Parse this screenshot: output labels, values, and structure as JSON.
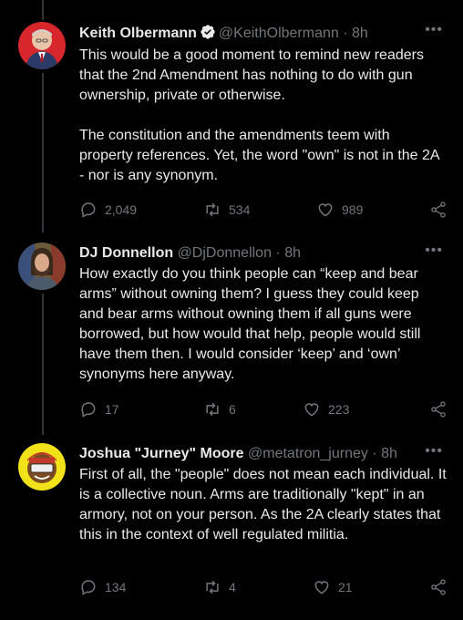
{
  "colors": {
    "background": "#000000",
    "text": "#e7e9ea",
    "muted": "#71767b",
    "verified": "#e7e9ea"
  },
  "tweets": [
    {
      "name": "Keith Olbermann",
      "verified": true,
      "handle": "@KeithOlbermann",
      "separator": "·",
      "time": "8h",
      "more": "•••",
      "text": "This would be a good moment to remind new readers that the 2nd Amendment has nothing to do with gun ownership, private or otherwise.\n\nThe constitution and the amendments teem with property references. Yet, the word \"own\" is not in the 2A - nor is any synonym.",
      "replies": "2,049",
      "retweets": "534",
      "likes": "989"
    },
    {
      "name": "DJ Donnellon",
      "verified": false,
      "handle": "@DjDonnellon",
      "separator": "·",
      "time": "8h",
      "more": "•••",
      "text": "How exactly do you think people can “keep and bear arms” without owning them? I guess they could keep and bear arms without owning them if all guns were borrowed, but how would that help, people would still have them then. I would consider ‘keep’ and ‘own’ synonyms here anyway.",
      "replies": "17",
      "retweets": "6",
      "likes": "223"
    },
    {
      "name": "Joshua \"Jurney\" Moore",
      "verified": false,
      "handle": "@metatron_jurney",
      "separator": "·",
      "time": "8h",
      "more": "•••",
      "text": "First of all, the \"people\" does not mean each individual. It is a collective noun. Arms are traditionally \"kept\" in an armory, not on your person. As the 2A clearly states that this in the context of well regulated militia.",
      "replies": "134",
      "retweets": "4",
      "likes": "21"
    }
  ]
}
